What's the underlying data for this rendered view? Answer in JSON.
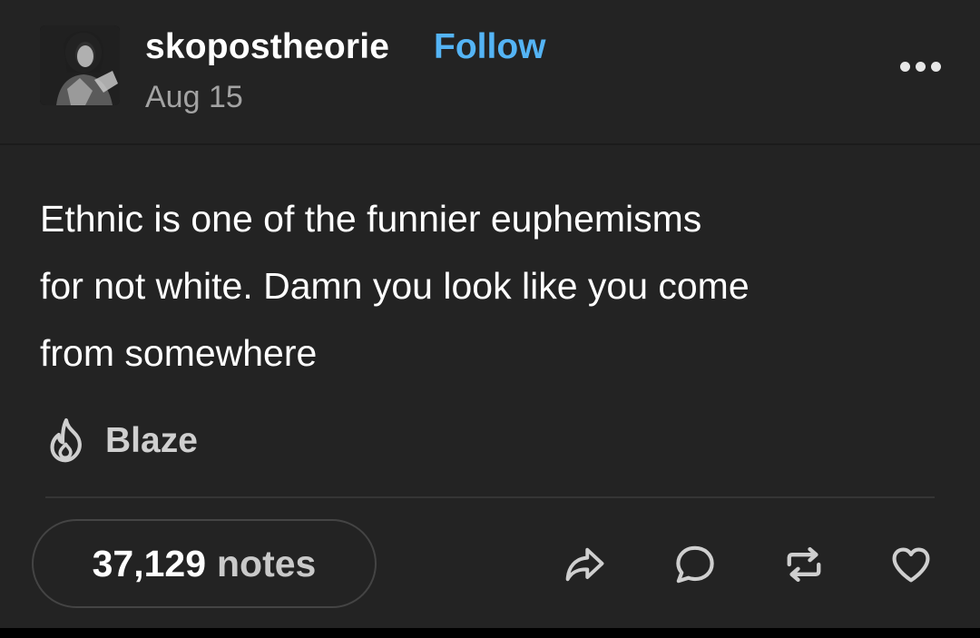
{
  "post": {
    "author": {
      "username": "skopostheorie",
      "follow_label": "Follow",
      "date": "Aug 15"
    },
    "more_icon": "ellipsis-icon",
    "body": [
      "Ethnic is one of the funnier euphemisms",
      "for not white. Damn you look like you come",
      "from somewhere"
    ],
    "blaze": {
      "label": "Blaze",
      "icon": "flame-icon"
    },
    "footer": {
      "notes_count": "37,129",
      "notes_label": "notes",
      "actions": [
        "share-icon",
        "comment-icon",
        "reblog-icon",
        "like-icon"
      ]
    }
  },
  "colors": {
    "background": "#232323",
    "follow": "#54b4f5",
    "muted_text": "#a3a3a3",
    "text": "#ffffff"
  }
}
